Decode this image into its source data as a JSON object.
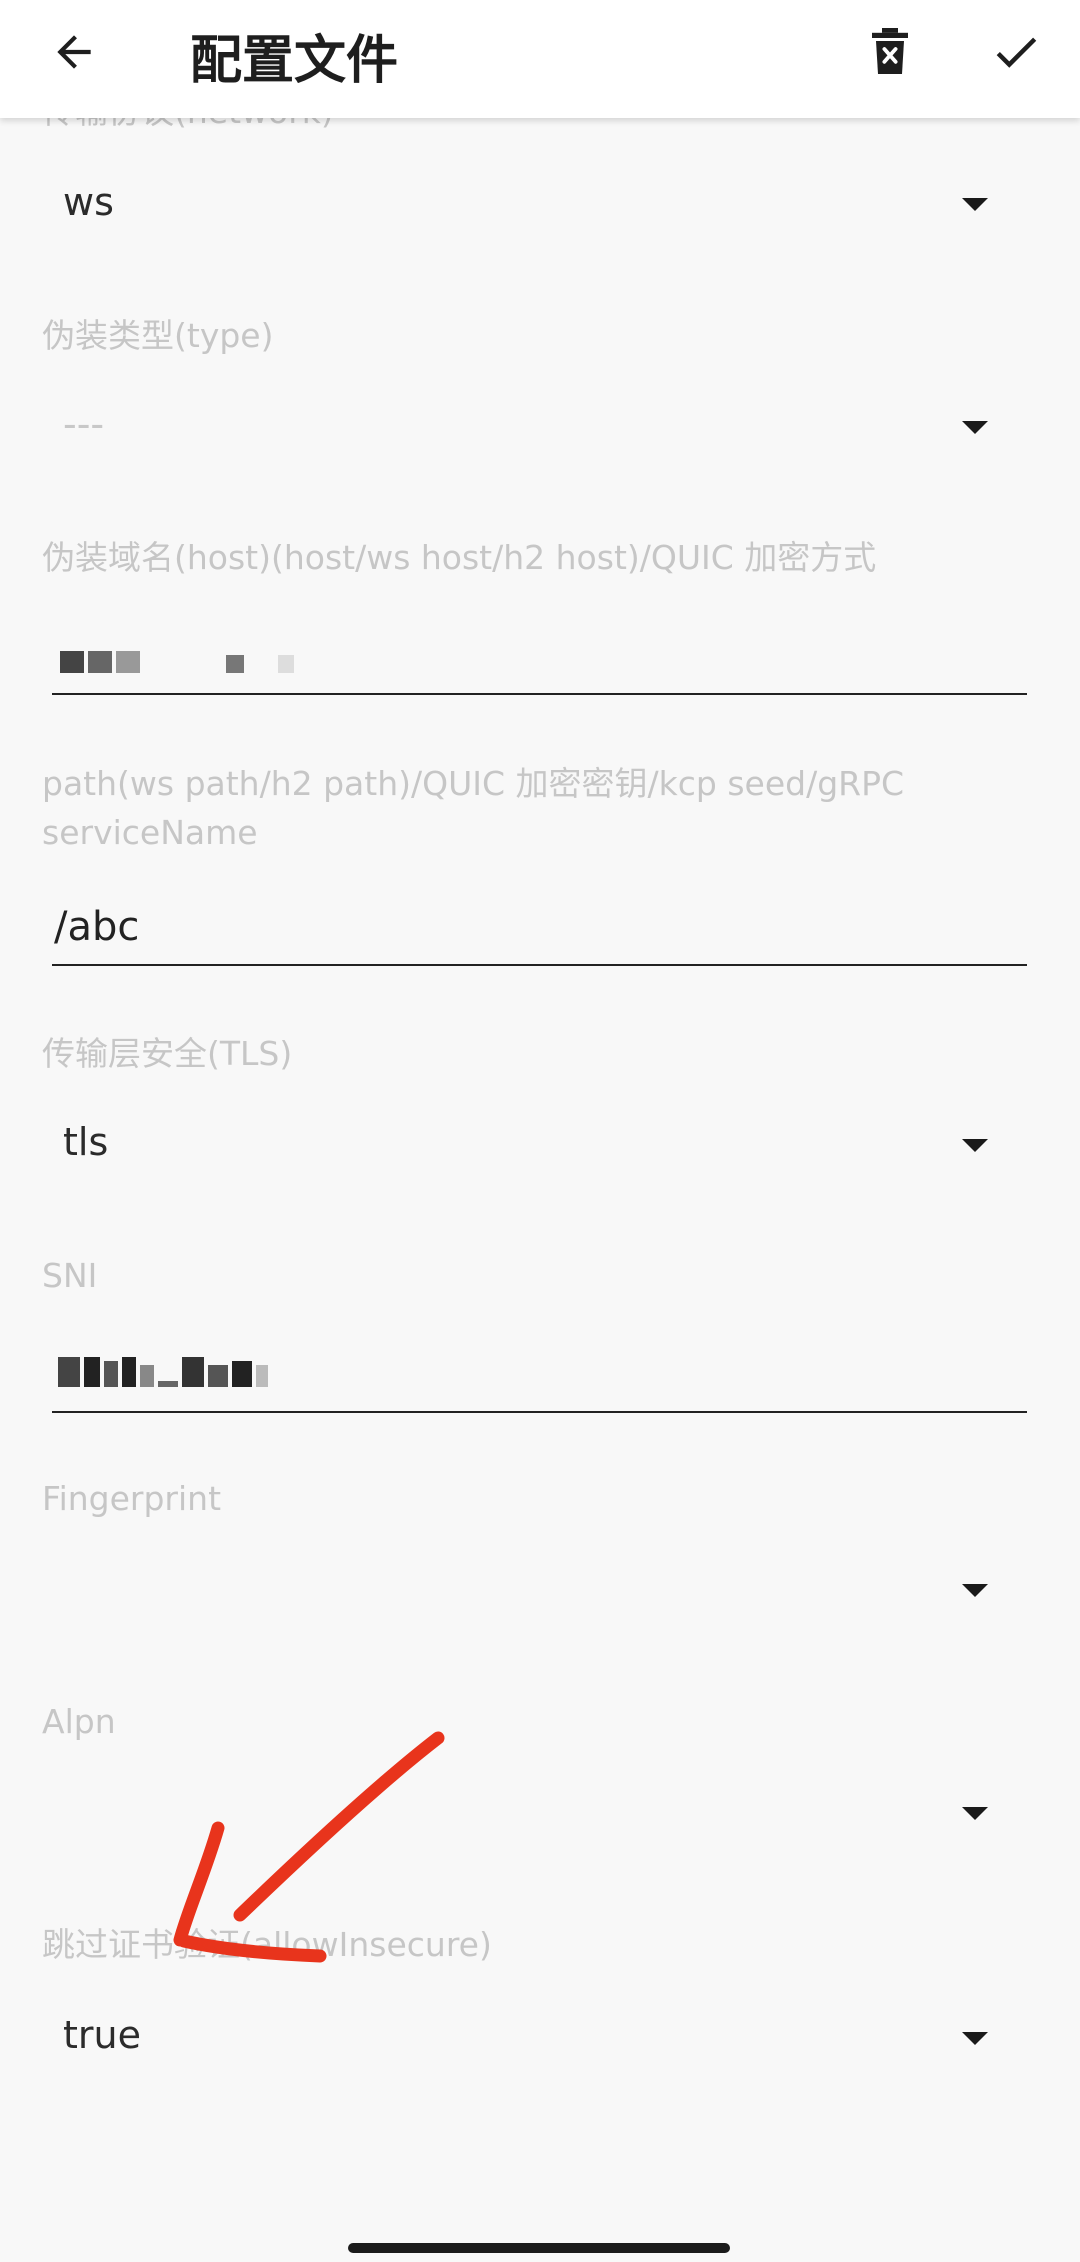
{
  "toolbar": {
    "title": "配置文件",
    "back_icon": "arrow-back-icon",
    "delete_icon": "delete-icon",
    "confirm_icon": "check-icon"
  },
  "fields": {
    "network": {
      "label": "传输协议(network)",
      "value": "ws"
    },
    "type": {
      "label": "伪装类型(type)",
      "value": "---"
    },
    "host": {
      "label": "伪装域名(host)(host/ws host/h2 host)/QUIC 加密方式"
    },
    "path": {
      "label_line1": "path(ws path/h2 path)/QUIC 加密密钥/kcp seed/gRPC",
      "label_line2": "serviceName",
      "value": "/abc"
    },
    "tls": {
      "label": "传输层安全(TLS)",
      "value": "tls"
    },
    "sni": {
      "label": "SNI"
    },
    "fingerprint": {
      "label": "Fingerprint",
      "value": ""
    },
    "alpn": {
      "label": "Alpn",
      "value": ""
    },
    "allow_insecure": {
      "label": "跳过证书验证(allowInsecure)",
      "value": "true"
    }
  },
  "colors": {
    "background": "#f8f8f8",
    "toolbar": "#ffffff",
    "label": "#c6c6c6",
    "text": "#222222",
    "annotation_arrow": "#e8341c"
  }
}
